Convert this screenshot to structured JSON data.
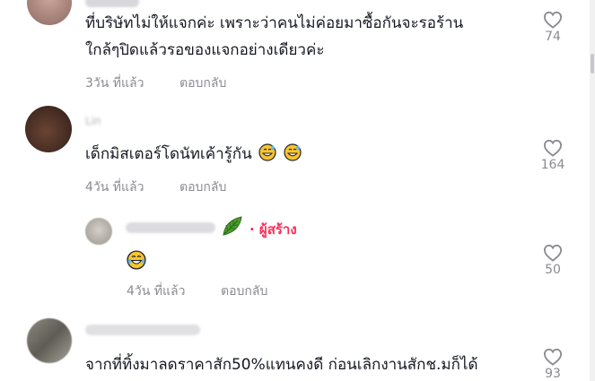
{
  "comments": [
    {
      "text_line1": "ที่บริษัทไม่ให้แจกค่ะ เพราะว่าคนไม่ค่อยมาซื้อกันจะรอร้าน",
      "text_line2": "ใกล้ๆปิดแล้วรอของแจกอย่างเดียวค่ะ",
      "time": "3วัน ที่แล้ว",
      "reply": "ตอบกลับ",
      "likes": "74"
    },
    {
      "username": "Lin",
      "text": "เด็กมิสเตอร์โดนัทเค้ารู้กัน",
      "time": "4วัน ที่แล้ว",
      "reply": "ตอบกลับ",
      "likes": "164"
    },
    {
      "creator_badge": "· ผู้สร้าง",
      "time": "4วัน ที่แล้ว",
      "reply": "ตอบกลับ",
      "likes": "50"
    },
    {
      "text": "จากที่ทิ้งมาลดราคาสัก50%แทนคงดี ก่อนเลิกงานสักช.มก็ได้",
      "likes": "93"
    }
  ],
  "icons": {
    "like": "heart-outline-icon",
    "leaf": "leaf-emoji-icon",
    "grin": "grinning-sweat-emoji-icon",
    "laugh": "tears-of-joy-emoji-icon"
  },
  "colors": {
    "creator": "#fe2c55",
    "meta": "#8a8b91"
  }
}
